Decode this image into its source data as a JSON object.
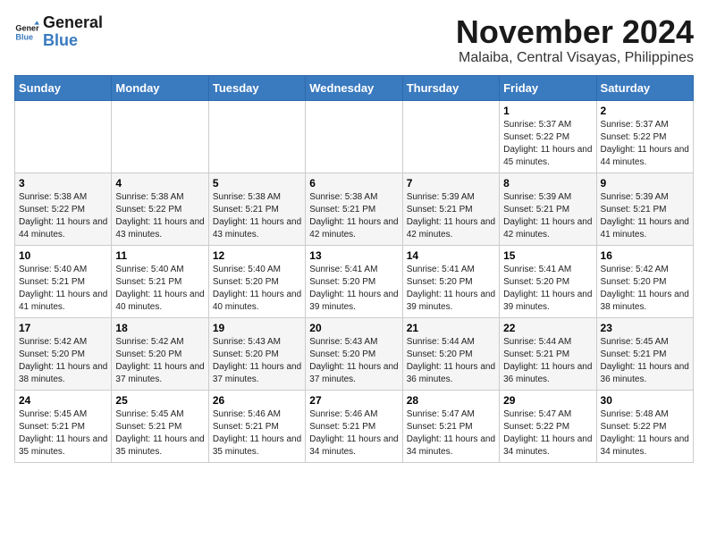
{
  "header": {
    "logo_line1": "General",
    "logo_line2": "Blue",
    "month": "November 2024",
    "location": "Malaiba, Central Visayas, Philippines"
  },
  "weekdays": [
    "Sunday",
    "Monday",
    "Tuesday",
    "Wednesday",
    "Thursday",
    "Friday",
    "Saturday"
  ],
  "weeks": [
    [
      {
        "day": "",
        "info": ""
      },
      {
        "day": "",
        "info": ""
      },
      {
        "day": "",
        "info": ""
      },
      {
        "day": "",
        "info": ""
      },
      {
        "day": "",
        "info": ""
      },
      {
        "day": "1",
        "info": "Sunrise: 5:37 AM\nSunset: 5:22 PM\nDaylight: 11 hours and 45 minutes."
      },
      {
        "day": "2",
        "info": "Sunrise: 5:37 AM\nSunset: 5:22 PM\nDaylight: 11 hours and 44 minutes."
      }
    ],
    [
      {
        "day": "3",
        "info": "Sunrise: 5:38 AM\nSunset: 5:22 PM\nDaylight: 11 hours and 44 minutes."
      },
      {
        "day": "4",
        "info": "Sunrise: 5:38 AM\nSunset: 5:22 PM\nDaylight: 11 hours and 43 minutes."
      },
      {
        "day": "5",
        "info": "Sunrise: 5:38 AM\nSunset: 5:21 PM\nDaylight: 11 hours and 43 minutes."
      },
      {
        "day": "6",
        "info": "Sunrise: 5:38 AM\nSunset: 5:21 PM\nDaylight: 11 hours and 42 minutes."
      },
      {
        "day": "7",
        "info": "Sunrise: 5:39 AM\nSunset: 5:21 PM\nDaylight: 11 hours and 42 minutes."
      },
      {
        "day": "8",
        "info": "Sunrise: 5:39 AM\nSunset: 5:21 PM\nDaylight: 11 hours and 42 minutes."
      },
      {
        "day": "9",
        "info": "Sunrise: 5:39 AM\nSunset: 5:21 PM\nDaylight: 11 hours and 41 minutes."
      }
    ],
    [
      {
        "day": "10",
        "info": "Sunrise: 5:40 AM\nSunset: 5:21 PM\nDaylight: 11 hours and 41 minutes."
      },
      {
        "day": "11",
        "info": "Sunrise: 5:40 AM\nSunset: 5:21 PM\nDaylight: 11 hours and 40 minutes."
      },
      {
        "day": "12",
        "info": "Sunrise: 5:40 AM\nSunset: 5:20 PM\nDaylight: 11 hours and 40 minutes."
      },
      {
        "day": "13",
        "info": "Sunrise: 5:41 AM\nSunset: 5:20 PM\nDaylight: 11 hours and 39 minutes."
      },
      {
        "day": "14",
        "info": "Sunrise: 5:41 AM\nSunset: 5:20 PM\nDaylight: 11 hours and 39 minutes."
      },
      {
        "day": "15",
        "info": "Sunrise: 5:41 AM\nSunset: 5:20 PM\nDaylight: 11 hours and 39 minutes."
      },
      {
        "day": "16",
        "info": "Sunrise: 5:42 AM\nSunset: 5:20 PM\nDaylight: 11 hours and 38 minutes."
      }
    ],
    [
      {
        "day": "17",
        "info": "Sunrise: 5:42 AM\nSunset: 5:20 PM\nDaylight: 11 hours and 38 minutes."
      },
      {
        "day": "18",
        "info": "Sunrise: 5:42 AM\nSunset: 5:20 PM\nDaylight: 11 hours and 37 minutes."
      },
      {
        "day": "19",
        "info": "Sunrise: 5:43 AM\nSunset: 5:20 PM\nDaylight: 11 hours and 37 minutes."
      },
      {
        "day": "20",
        "info": "Sunrise: 5:43 AM\nSunset: 5:20 PM\nDaylight: 11 hours and 37 minutes."
      },
      {
        "day": "21",
        "info": "Sunrise: 5:44 AM\nSunset: 5:20 PM\nDaylight: 11 hours and 36 minutes."
      },
      {
        "day": "22",
        "info": "Sunrise: 5:44 AM\nSunset: 5:21 PM\nDaylight: 11 hours and 36 minutes."
      },
      {
        "day": "23",
        "info": "Sunrise: 5:45 AM\nSunset: 5:21 PM\nDaylight: 11 hours and 36 minutes."
      }
    ],
    [
      {
        "day": "24",
        "info": "Sunrise: 5:45 AM\nSunset: 5:21 PM\nDaylight: 11 hours and 35 minutes."
      },
      {
        "day": "25",
        "info": "Sunrise: 5:45 AM\nSunset: 5:21 PM\nDaylight: 11 hours and 35 minutes."
      },
      {
        "day": "26",
        "info": "Sunrise: 5:46 AM\nSunset: 5:21 PM\nDaylight: 11 hours and 35 minutes."
      },
      {
        "day": "27",
        "info": "Sunrise: 5:46 AM\nSunset: 5:21 PM\nDaylight: 11 hours and 34 minutes."
      },
      {
        "day": "28",
        "info": "Sunrise: 5:47 AM\nSunset: 5:21 PM\nDaylight: 11 hours and 34 minutes."
      },
      {
        "day": "29",
        "info": "Sunrise: 5:47 AM\nSunset: 5:22 PM\nDaylight: 11 hours and 34 minutes."
      },
      {
        "day": "30",
        "info": "Sunrise: 5:48 AM\nSunset: 5:22 PM\nDaylight: 11 hours and 34 minutes."
      }
    ]
  ]
}
